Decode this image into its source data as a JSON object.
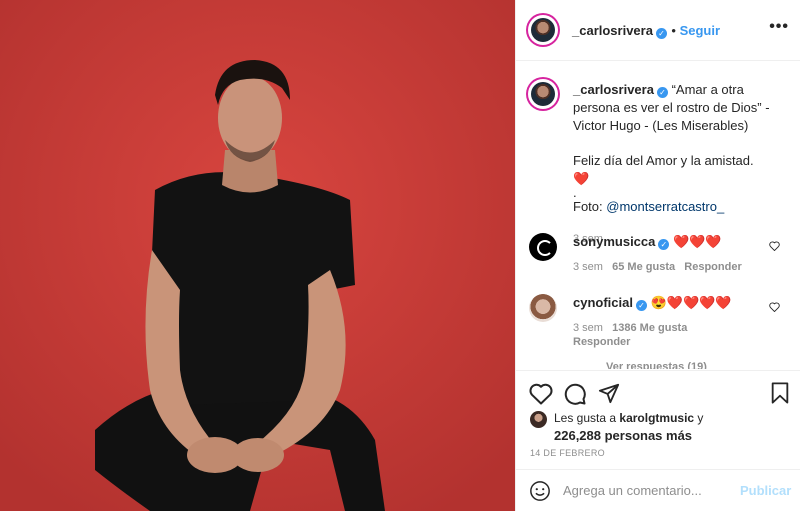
{
  "post": {
    "username": "_carlosrivera",
    "follow_label": "Seguir",
    "more_label": "•••",
    "caption": {
      "line1": "“Amar a otra",
      "line2": "persona es ver el rostro de Dios” -",
      "line3": "Victor Hugo - (Les Miserables)",
      "line4": "Feliz día del Amor y la amistad. ❤️",
      "line5": ".",
      "line6_prefix": "Foto: ",
      "line6_mention": "@montserratcastro_",
      "time": "3 sem"
    },
    "comments": [
      {
        "user": "sonymusicca",
        "text": "❤️❤️❤️",
        "time": "3 sem",
        "likes": "65 Me gusta",
        "reply": "Responder"
      },
      {
        "user": "cynoficial",
        "text": "😍❤️❤️❤️❤️",
        "time": "3 sem",
        "likes": "1386 Me gusta",
        "reply": "Responder"
      }
    ],
    "view_replies": "Ver respuestas (19)",
    "likes_prefix": "Les gusta a ",
    "likes_user": "karolgtmusic",
    "likes_suffix": " y",
    "likes_count": "226,288 personas más",
    "date": "14 DE FEBRERO",
    "comment_placeholder": "Agrega un comentario...",
    "publish_label": "Publicar"
  },
  "colors": {
    "accent": "#3897f0",
    "photo_bg": "#c93b38",
    "heart": "#ed4956"
  },
  "icons": [
    "verified-icon",
    "more-icon",
    "heart-icon",
    "comment-icon",
    "share-icon",
    "bookmark-icon",
    "emoji-icon"
  ]
}
